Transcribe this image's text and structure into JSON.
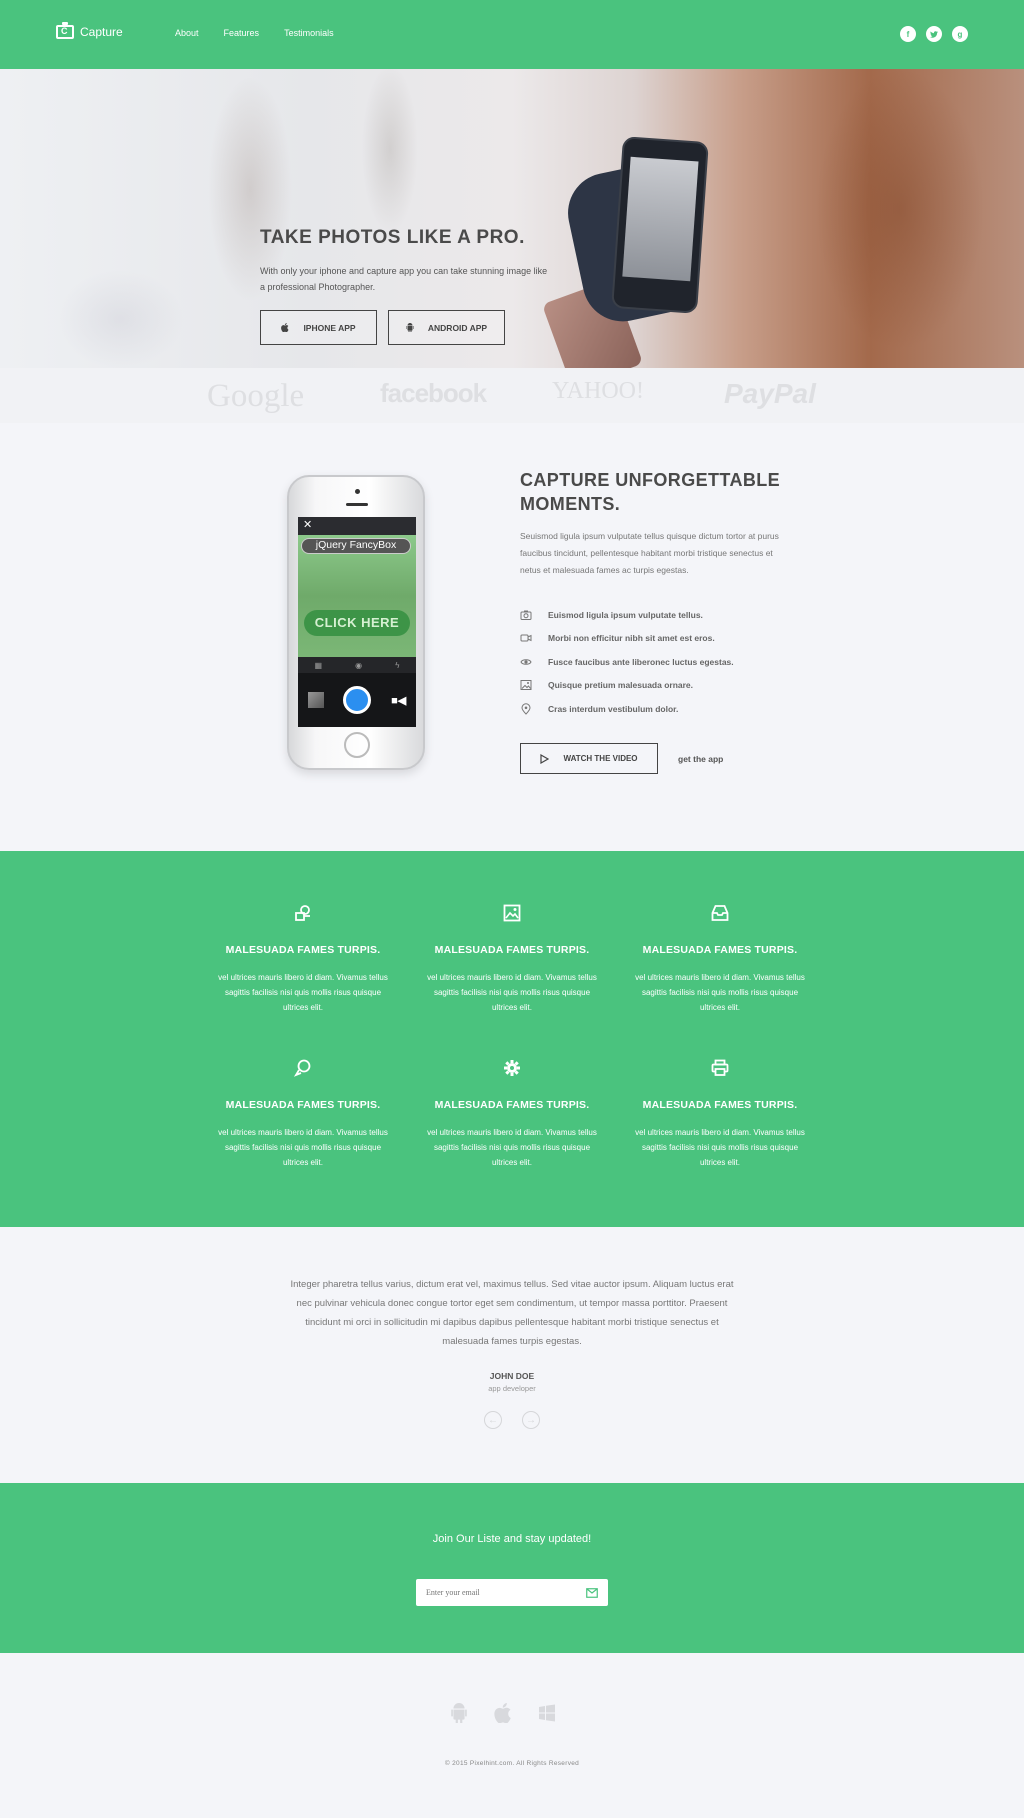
{
  "header": {
    "brand": "Capture",
    "nav": [
      "About",
      "Features",
      "Testimonials"
    ],
    "social": [
      "f",
      "t",
      "g"
    ]
  },
  "hero": {
    "title": "TAKE PHOTOS LIKE A PRO.",
    "text": "With only your iphone and capture app you can take stunning image like a professional Photographer.",
    "iphone_btn": "IPHONE APP",
    "android_btn": "ANDROID APP"
  },
  "logos": [
    "Google",
    "facebook",
    "YAHOO!",
    "PayPal"
  ],
  "feature": {
    "phone": {
      "overlay_title": "jQuery FancyBox",
      "overlay_button": "CLICK HERE",
      "close": "✕"
    },
    "title": "CAPTURE UNFORGETTABLE MOMENTS.",
    "text": "Seuismod ligula ipsum vulputate tellus quisque dictum tortor at purus faucibus tincidunt, pellentesque habitant morbi tristique senectus et netus et malesuada fames ac turpis egestas.",
    "list": [
      {
        "icon": "camera-icon",
        "text": "Euismod ligula ipsum vulputate tellus."
      },
      {
        "icon": "video-icon",
        "text": "Morbi non efficitur nibh sit amet est eros."
      },
      {
        "icon": "eye-icon",
        "text": "Fusce faucibus ante liberonec luctus egestas."
      },
      {
        "icon": "image-icon",
        "text": "Quisque pretium malesuada ornare."
      },
      {
        "icon": "location-icon",
        "text": "Cras interdum vestibulum dolor."
      }
    ],
    "watch_btn": "WATCH THE VIDEO",
    "get_app": "get the app"
  },
  "grid": {
    "items": [
      {
        "icon": "shapes-icon",
        "title": "MALESUADA FAMES TURPIS.",
        "text": "vel ultrices mauris libero id diam. Vivamus tellus sagittis facilisis nisi quis mollis risus quisque ultrices elit."
      },
      {
        "icon": "image-icon",
        "title": "MALESUADA FAMES TURPIS.",
        "text": "vel ultrices mauris libero id diam. Vivamus tellus sagittis facilisis nisi quis mollis risus quisque ultrices elit."
      },
      {
        "icon": "inbox-icon",
        "title": "MALESUADA FAMES TURPIS.",
        "text": "vel ultrices mauris libero id diam. Vivamus tellus sagittis facilisis nisi quis mollis risus quisque ultrices elit."
      },
      {
        "icon": "chat-icon",
        "title": "MALESUADA FAMES TURPIS.",
        "text": "vel ultrices mauris libero id diam. Vivamus tellus sagittis facilisis nisi quis mollis risus quisque ultrices elit."
      },
      {
        "icon": "gear-icon",
        "title": "MALESUADA FAMES TURPIS.",
        "text": "vel ultrices mauris libero id diam. Vivamus tellus sagittis facilisis nisi quis mollis risus quisque ultrices elit."
      },
      {
        "icon": "printer-icon",
        "title": "MALESUADA FAMES TURPIS.",
        "text": "vel ultrices mauris libero id diam. Vivamus tellus sagittis facilisis nisi quis mollis risus quisque ultrices elit."
      }
    ]
  },
  "testimonial": {
    "quote": "Integer pharetra tellus varius, dictum erat vel, maximus tellus. Sed vitae auctor ipsum. Aliquam luctus erat nec pulvinar vehicula donec congue tortor eget sem condimentum, ut tempor massa porttitor. Praesent tincidunt mi orci in sollicitudin mi dapibus dapibus pellentesque habitant morbi tristique senectus et malesuada fames turpis egestas.",
    "name": "JOHN DOE",
    "role": "app developer"
  },
  "newsletter": {
    "title": "Join Our Liste and stay updated!",
    "placeholder": "Enter your email"
  },
  "footer": {
    "icons": [
      "android-icon",
      "apple-icon",
      "windows-icon"
    ],
    "copyright": "© 2015 Pixelhint.com. All Rights Reserved"
  },
  "colors": {
    "brand": "#4ac37e",
    "background": "#f4f5f9",
    "shutter": "#2b8ff0"
  }
}
